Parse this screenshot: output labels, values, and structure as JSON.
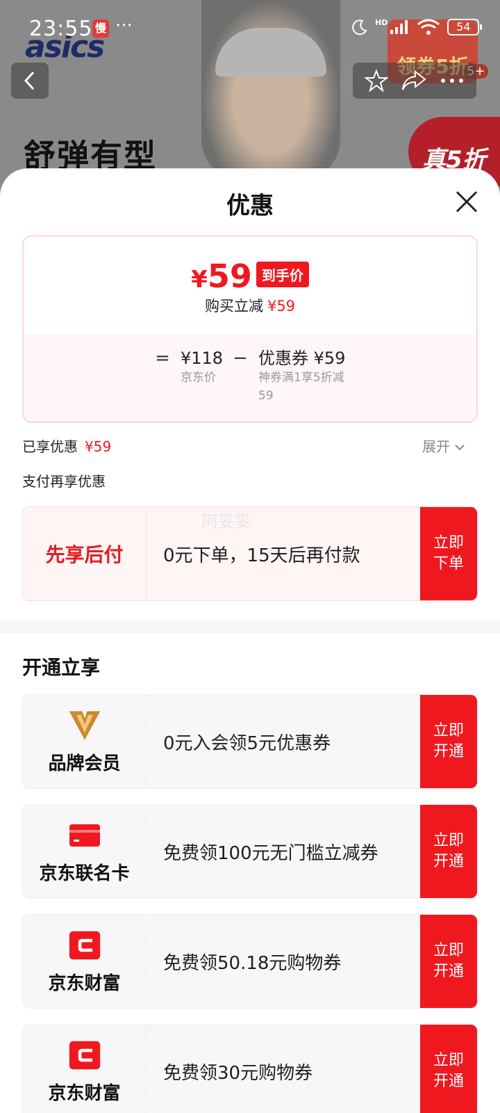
{
  "status_bar": {
    "time": "23:55",
    "app_indicator": "慢",
    "overflow": "···",
    "network": "HD",
    "battery": "54"
  },
  "background": {
    "brand_logo": "asics",
    "headline": "舒弹有型",
    "badge": "领券5折",
    "badge_count": "5+",
    "ribbon": "真5折"
  },
  "sheet": {
    "title": "优惠",
    "price": {
      "currency": "¥",
      "amount": "59",
      "tag": "到手价",
      "sub_label": "购买立减",
      "sub_value": "¥59"
    },
    "formula": {
      "equals": "=",
      "minus": "−",
      "base_value": "¥118",
      "base_note": "京东价",
      "coupon_value": "优惠券 ¥59",
      "coupon_note": "神券满1享5折减59"
    },
    "enjoyed_label": "已享优惠",
    "enjoyed_value": "¥59",
    "expand_label": "展开",
    "pay_more_label": "支付再享优惠",
    "bnpl": {
      "title": "先享后付",
      "desc": "0元下单，15天后再付款",
      "button": "立即下单",
      "watermark": "阿妥妥"
    },
    "section_title": "开通立享",
    "offers": [
      {
        "label": "品牌会员",
        "icon": "brand-v-icon",
        "desc": "0元入会领5元优惠券",
        "button": "立即开通"
      },
      {
        "label": "京东联名卡",
        "icon": "card-icon",
        "desc": "免费领100元无门槛立减券",
        "button": "立即开通"
      },
      {
        "label": "京东财富",
        "icon": "wealth-icon",
        "desc": "免费领50.18元购物券",
        "button": "立即开通"
      },
      {
        "label": "京东财富",
        "icon": "wealth-icon",
        "desc": "免费领30元购物券",
        "button": "立即开通"
      }
    ]
  },
  "colors": {
    "accent": "#f0181f",
    "brand_gold": "#c98a2b"
  }
}
